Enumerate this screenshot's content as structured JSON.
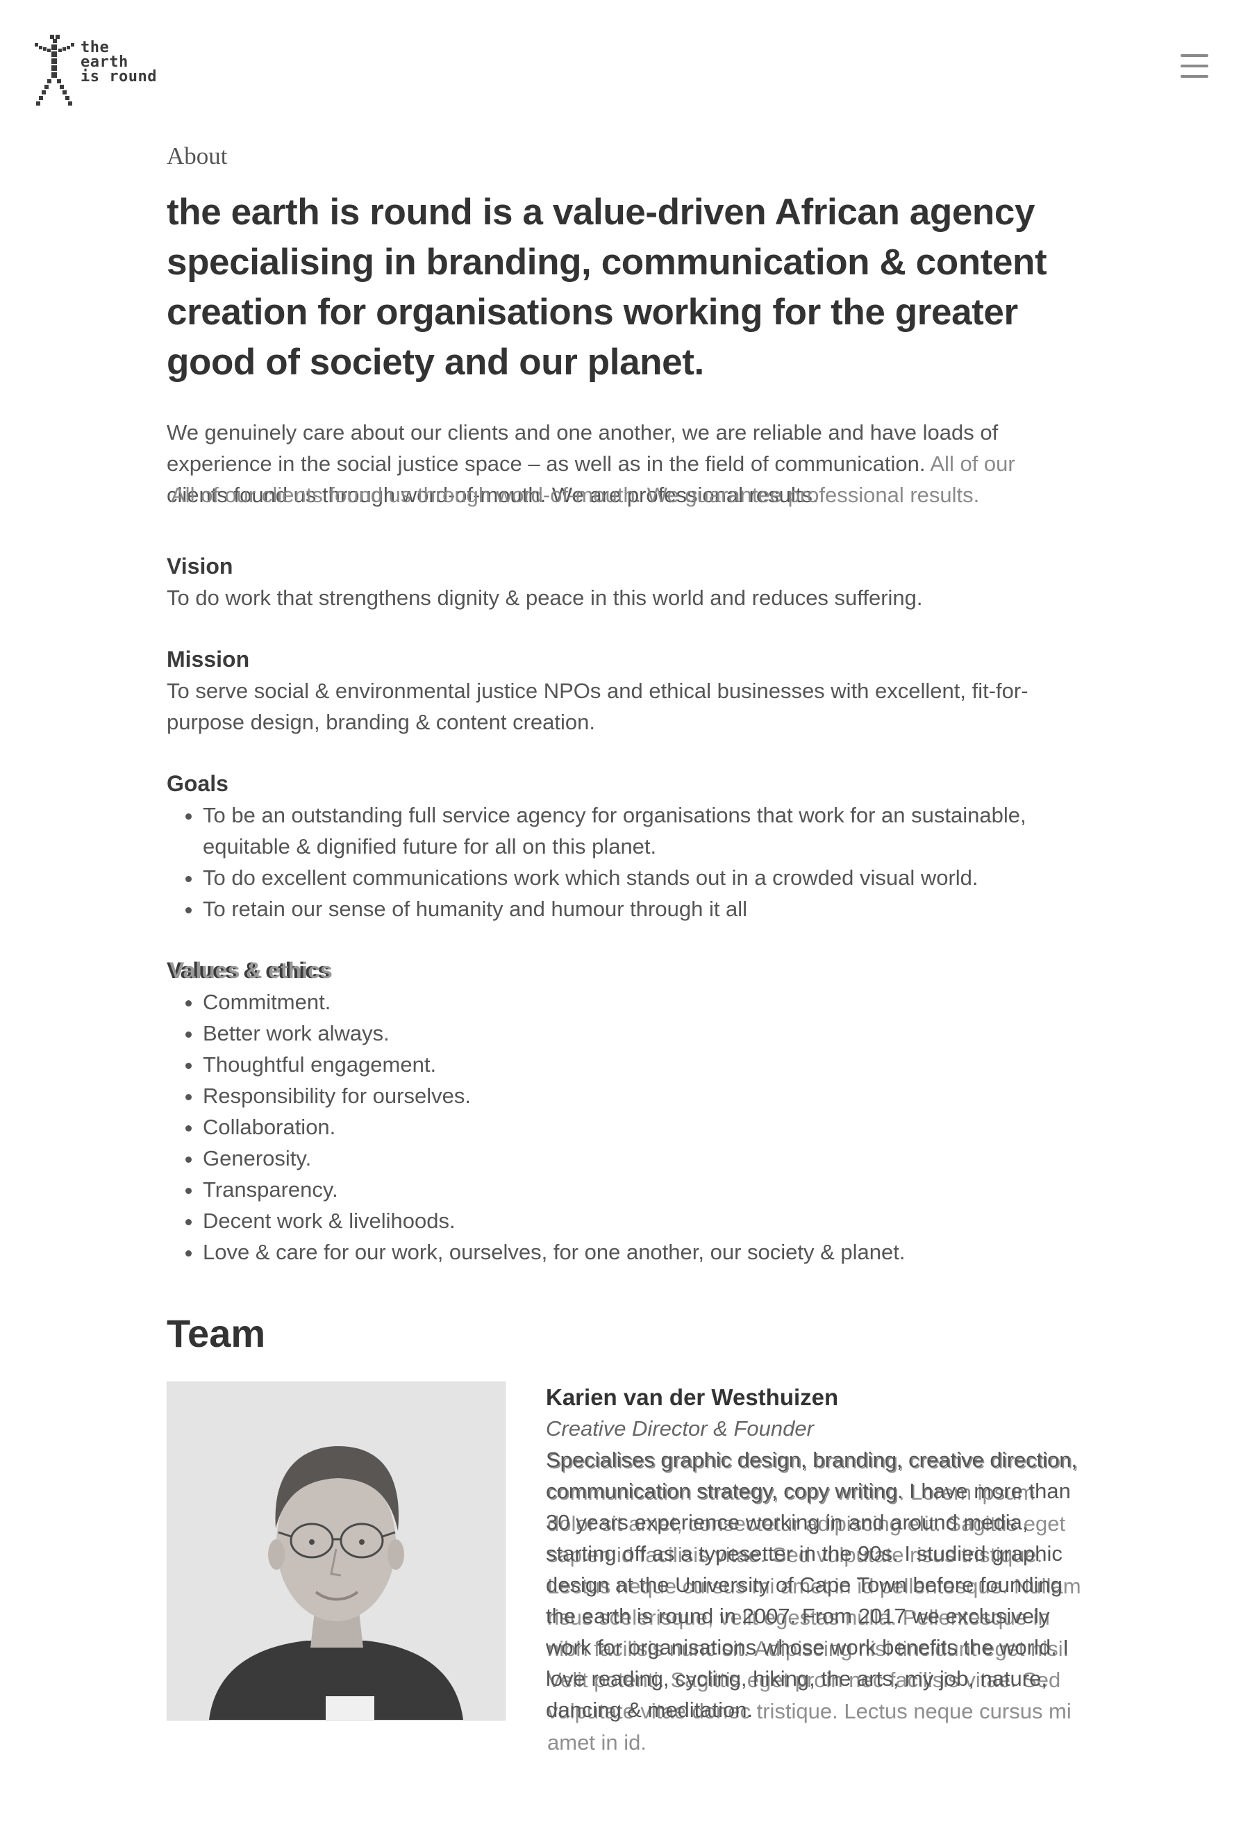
{
  "header": {
    "logo_lines": [
      "the",
      "earth",
      "is round"
    ],
    "menu_icon": "hamburger-menu-icon"
  },
  "about": {
    "eyebrow": "About",
    "lead": "the earth is round is a value-driven African agency specialising in branding, communication & content creation for organisations working for the greater good of society and our planet.",
    "intro_main": "We genuinely care about our clients and one another, we are reliable and have loads of experience in the social justice space – as well as in the field of communication.",
    "intro_faint": "All of our",
    "intro_overlap_a": "clients found us through word-of-mouth. We are professional results.",
    "intro_overlap_b": "All of our clients found us through word-of-mouth. We guarantee professional results."
  },
  "vision": {
    "heading": "Vision",
    "text": "To do work that strengthens dignity & peace in this world and reduces suffering."
  },
  "mission": {
    "heading": "Mission",
    "text": "To serve social & environmental justice NPOs and ethical businesses with excellent, fit-for-purpose design, branding & content creation."
  },
  "goals": {
    "heading": "Goals",
    "items": [
      "To be an outstanding full service agency for organisations that work for an sustainable, equitable & dignified future for all on this planet.",
      "To do excellent communications work which stands out in a crowded visual world.",
      "To retain our sense of humanity and humour through it all"
    ]
  },
  "values": {
    "heading": "Values & ethics",
    "heading_overlap": "Values & ethics",
    "items": [
      "Commitment.",
      "Better work always.",
      "Thoughtful engagement.",
      "Responsibility for ourselves.",
      "Collaboration.",
      "Generosity.",
      "Transparency.",
      "Decent work & livelihoods.",
      "Love & care for our work, ourselves, for one another, our society & planet."
    ]
  },
  "team": {
    "title": "Team",
    "members": [
      {
        "name": "Karien van der Westhuizen",
        "role": "Creative Director & Founder",
        "bio_a": "Specialises graphic design, branding, creative direction, communication strategy, copy writing. I have more than 30 years experience working in and around media, starting off as a typesetter in the 90s. I studied graphic design at the University of Cape Town before founding the earth is round in 2007. From 2017 we exclusively work for organisations whose work benefits the world. I love reading, cycling, hiking, the arts, my job, nature, dancing & meditation.",
        "bio_b": "Specialises graphic design, branding, creative direction, communication strategy, copy writing. Lorem ipsum dolor sit amet, consectetur adipiscing elit. Sagittis eget sapien id facilisis vitae. Sed vulputate risus tristique. Lectus neque cursus mi amet in id pellentesque. Nullam risus scelerisque, velit egestas nulla. Pellentesque in nibh facilisis nunc sit. Adipiscing nisi tincidunt eget nisi. Velit potenti. Sagittis eget proin nec facilisis vitae. Sed vulputate vitae donec tristique. Lectus neque cursus mi amet in id."
      }
    ]
  },
  "colors": {
    "background": "#ffffff",
    "text_dark": "#333333",
    "text_body": "#555555",
    "text_faint": "#8a8a8a"
  }
}
